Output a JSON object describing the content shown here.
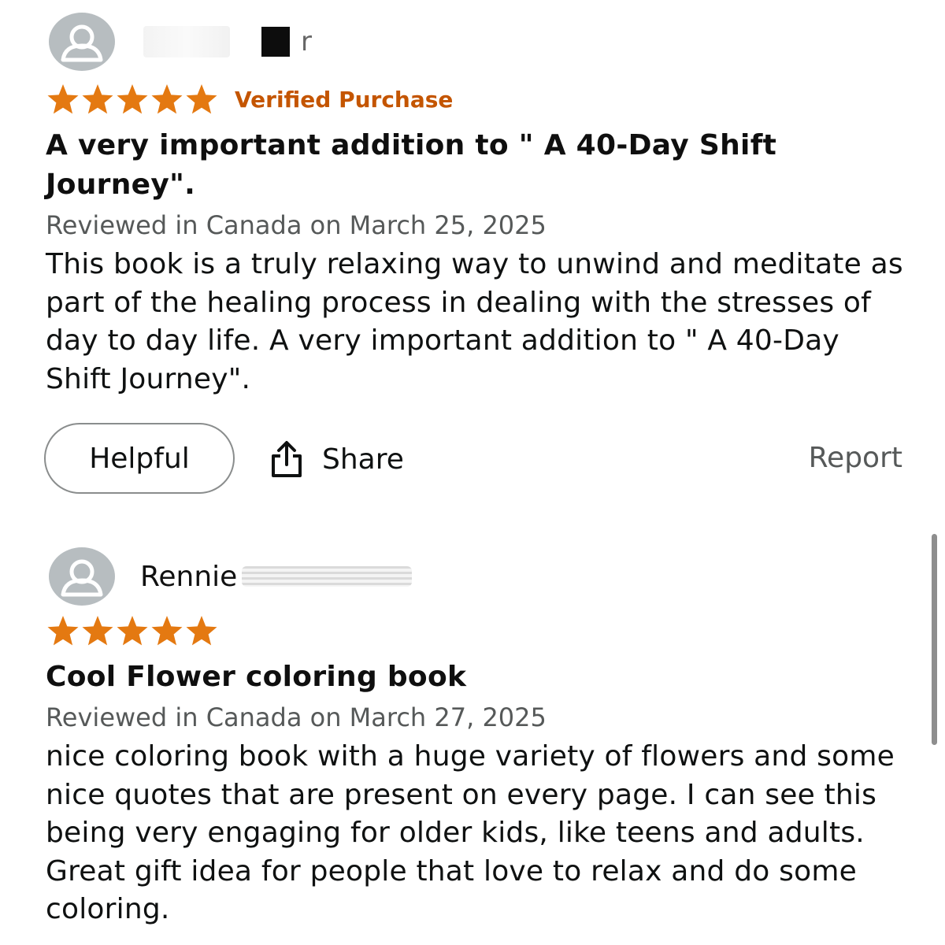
{
  "colors": {
    "star": "#e47911",
    "verified": "#c45500",
    "avatar": "#b7bdc0"
  },
  "reviews": [
    {
      "reviewer": {
        "name_tail": "r",
        "avatar_icon": "user-avatar-icon"
      },
      "stars": 5,
      "verified_label": "Verified Purchase",
      "title": "A very important addition to \" A 40-Day Shift Journey\".",
      "date": "Reviewed in Canada on March 25, 2025",
      "body": "This book is a truly relaxing way to unwind and meditate as part of the healing process in dealing with the stresses of day to day life. A very important addition to \" A 40-Day Shift Journey\"."
    },
    {
      "reviewer": {
        "name": "Rennie",
        "avatar_icon": "user-avatar-icon"
      },
      "stars": 5,
      "title": "Cool Flower coloring book",
      "date": "Reviewed in Canada on March 27, 2025",
      "body": "nice coloring book with a huge variety of flowers and some nice quotes that are present on every page. I can see this being very engaging for older kids, like teens and adults. Great gift idea for people that love to relax and do some coloring."
    }
  ],
  "actions": {
    "helpful_label": "Helpful",
    "share_label": "Share",
    "share_icon": "share-icon",
    "report_label": "Report"
  }
}
